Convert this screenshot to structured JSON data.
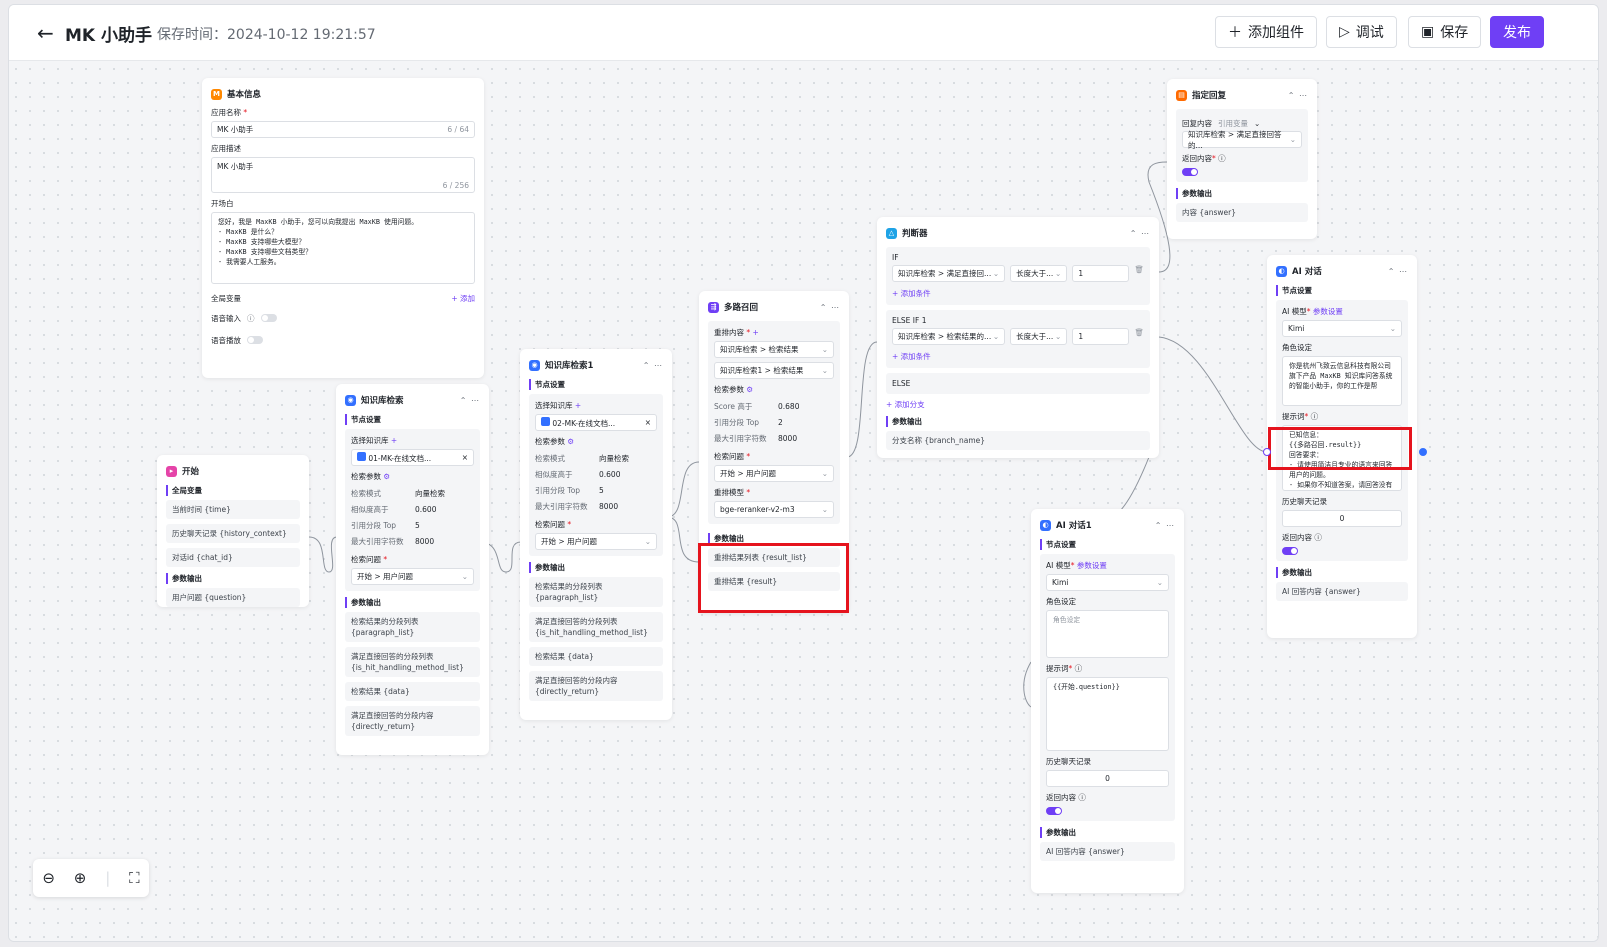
{
  "header": {
    "title": "MK 小助手",
    "save_time": "保存时间：2024-10-12 19:21:57",
    "add_component": "添加组件",
    "debug": "调试",
    "save": "保存",
    "publish": "发布"
  },
  "base_info": {
    "title": "基本信息",
    "app_name_label": "应用名称",
    "app_name": "MK 小助手",
    "app_name_count": "6 / 64",
    "desc_label": "应用描述",
    "desc": "MK 小助手",
    "desc_count": "6 / 256",
    "opening_label": "开场白",
    "opening": "您好，我是 MaxKB 小助手，您可以向我提出 MaxKB 使用问题。\n- MaxKB 是什么？\n- MaxKB 支持哪些大模型？\n- MaxKB 支持哪些文档类型？\n- 我需要人工服务。",
    "global_var_label": "全局变量",
    "add": "+ 添加",
    "voice_input": "语音输入",
    "voice_play": "语音播放"
  },
  "start": {
    "title": "开始",
    "global_vars": "全局变量",
    "items": [
      "当前时间 {time}",
      "历史聊天记录 {history_context}",
      "对话id {chat_id}"
    ],
    "output_label": "参数输出",
    "output": "用户问题 {question}"
  },
  "kb_search": {
    "title": "知识库检索",
    "node_settings": "节点设置",
    "select_kb": "选择知识库",
    "kb": "01-MK-在线文档...",
    "params_label": "检索参数",
    "params": [
      {
        "k": "检索模式",
        "v": "向量检索"
      },
      {
        "k": "相似度高于",
        "v": "0.600"
      },
      {
        "k": "引用分段 Top",
        "v": "5"
      },
      {
        "k": "最大引用字符数",
        "v": "8000"
      }
    ],
    "question_label": "检索问题",
    "question": "开始 > 用户问题",
    "output_label": "参数输出",
    "outputs": [
      "检索结果的分段列表 {paragraph_list}",
      "满足直接回答的分段列表 {is_hit_handling_method_list}",
      "检索结果 {data}",
      "满足直接回答的分段内容 {directly_return}"
    ]
  },
  "kb_search1": {
    "title": "知识库检索1",
    "node_settings": "节点设置",
    "select_kb": "选择知识库",
    "kb": "02-MK-在线文档...",
    "params_label": "检索参数",
    "params": [
      {
        "k": "检索模式",
        "v": "向量检索"
      },
      {
        "k": "相似度高于",
        "v": "0.600"
      },
      {
        "k": "引用分段 Top",
        "v": "5"
      },
      {
        "k": "最大引用字符数",
        "v": "8000"
      }
    ],
    "question_label": "检索问题",
    "question": "开始 > 用户问题",
    "output_label": "参数输出",
    "outputs": [
      "检索结果的分段列表 {paragraph_list}",
      "满足直接回答的分段列表 {is_hit_handling_method_list}",
      "检索结果 {data}",
      "满足直接回答的分段内容 {directly_return}"
    ]
  },
  "multi_recall": {
    "title": "多路召回",
    "rerank_label": "重排内容",
    "rerank_items": [
      "知识库检索 > 检索结果",
      "知识库检索1 > 检索结果"
    ],
    "params_label": "检索参数",
    "params": [
      {
        "k": "Score 高于",
        "v": "0.680"
      },
      {
        "k": "引用分段 Top",
        "v": "2"
      },
      {
        "k": "最大引用字符数",
        "v": "8000"
      }
    ],
    "question_label": "检索问题",
    "question": "开始 > 用户问题",
    "model_label": "重排模型",
    "model": "bge-reranker-v2-m3",
    "output_label": "参数输出",
    "outputs": [
      "重排结果列表 {result_list}",
      "重排结果 {result}"
    ]
  },
  "judge": {
    "title": "判断器",
    "if": "IF",
    "if_field": "知识库检索 > 满足直接回...",
    "if_op": "长度大于...",
    "if_val": "1",
    "add_cond": "+ 添加条件",
    "elseif": "ELSE IF 1",
    "elseif_field": "知识库检索 > 检索结果的...",
    "elseif_op": "长度大于...",
    "elseif_val": "1",
    "else": "ELSE",
    "add_branch": "+ 添加分支",
    "output_label": "参数输出",
    "output": "分支名称 {branch_name}"
  },
  "reply": {
    "title": "指定回复",
    "content_label": "回复内容",
    "ref_var": "引用变量",
    "content": "知识库检索 > 满足直接回答的...",
    "return_label": "返回内容",
    "output_label": "参数输出",
    "output": "内容 {answer}"
  },
  "ai_chat": {
    "title": "AI 对话",
    "node_settings": "节点设置",
    "model_label": "AI 模型",
    "param_settings": "参数设置",
    "model": "Kimi",
    "role_label": "角色设定",
    "role": "你是杭州飞致云信息科技有限公司旗下产品 MaxKB 知识库问答系统的智能小助手，你的工作是帮",
    "prompt_label": "提示词",
    "prompt": "已知信息：\n{{多路召回.result}}\n回答要求：\n- 请使用简洁且专业的语言来回答用户的问题。\n- 如果你不知道答案，请回答没有在知识库中查找到相关信息，建议咨询相关技术支持或参考官方文档进行操作。\n- 避免提及你是从已知信息中获得的知识。",
    "history_label": "历史聊天记录",
    "history": "0",
    "return_label": "返回内容",
    "output_label": "参数输出",
    "output": "AI 回答内容 {answer}"
  },
  "ai_chat1": {
    "title": "AI 对话1",
    "node_settings": "节点设置",
    "model_label": "AI 模型",
    "param_settings": "参数设置",
    "model": "Kimi",
    "role_label": "角色设定",
    "role_placeholder": "角色设定",
    "prompt_label": "提示词",
    "prompt": "{{开始.question}}",
    "history_label": "历史聊天记录",
    "history": "0",
    "return_label": "返回内容",
    "output_label": "参数输出",
    "output": "AI 回答内容 {answer}"
  },
  "colors": {
    "accent": "#6f3ff5",
    "highlight": "#e5131d",
    "kb_blue": "#3370ff"
  }
}
